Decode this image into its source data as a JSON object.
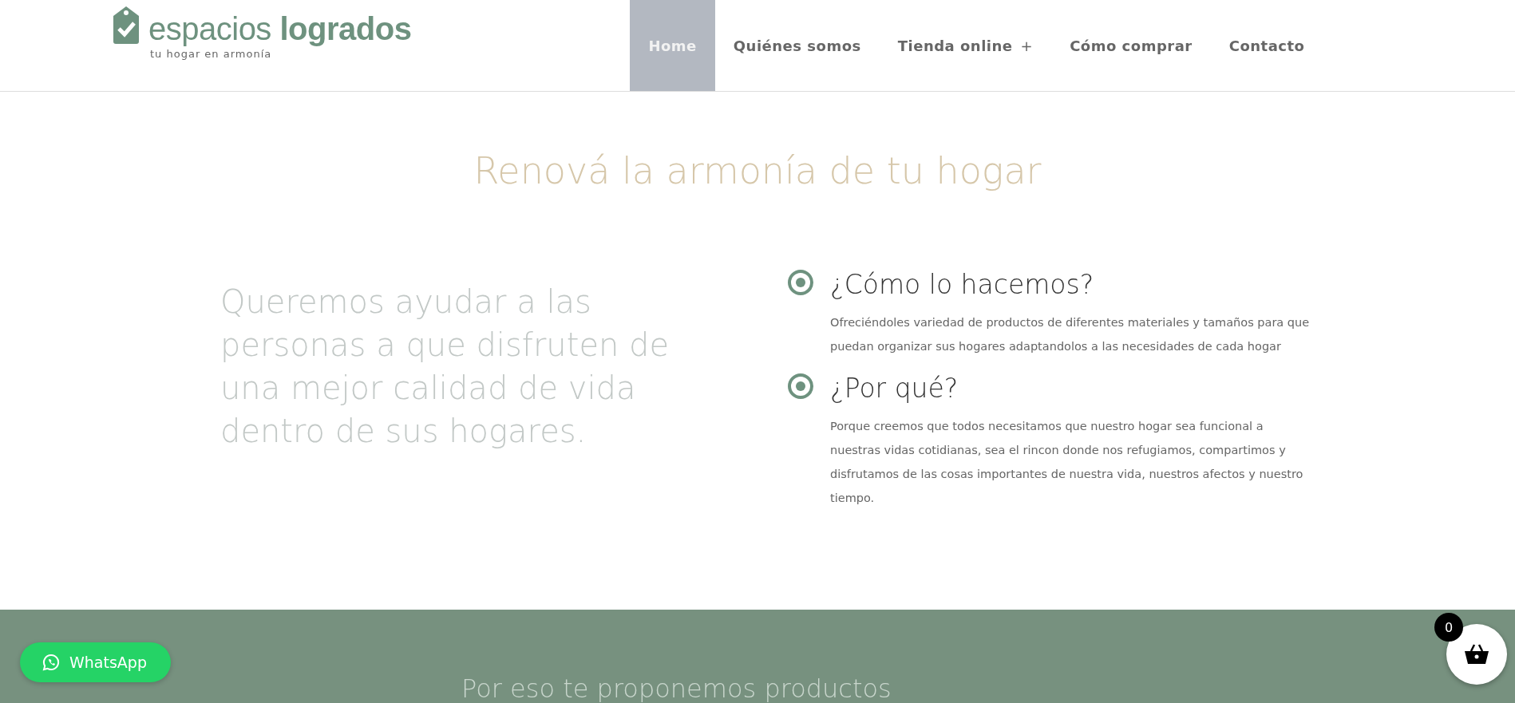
{
  "logo": {
    "name_light": "espacios",
    "name_bold": "logrados",
    "tagline": "tu hogar en armonía"
  },
  "nav": [
    {
      "label": "Home",
      "selected": true
    },
    {
      "label": "Quiénes somos",
      "selected": false
    },
    {
      "label": "Tienda online",
      "selected": false,
      "submenu": "+"
    },
    {
      "label": "Cómo comprar",
      "selected": false
    },
    {
      "label": "Contacto",
      "selected": false
    }
  ],
  "headline": "Renová la armonía de tu hogar",
  "mission": "Queremos ayudar a las personas a que disfruten de una mejor calidad de vida dentro de sus hogares.",
  "features": [
    {
      "title": "¿Cómo lo hacemos?",
      "text": "Ofreciéndoles variedad de productos de diferentes materiales y tamaños para que puedan organizar sus hogares adaptandolos a las necesidades de cada hogar"
    },
    {
      "title": "¿Por qué?",
      "text": "Porque creemos que todos necesitamos que nuestro hogar sea funcional a nuestras vidas cotidianas, sea el rincon donde nos refugiamos, compartimos y disfrutamos de las cosas importantes de nuestra vida, nuestros afectos y nuestro tiempo."
    }
  ],
  "banner": {
    "heading": "Por eso te proponemos productos"
  },
  "whatsapp": {
    "label": "WhatsApp"
  },
  "cart": {
    "count": "0"
  }
}
